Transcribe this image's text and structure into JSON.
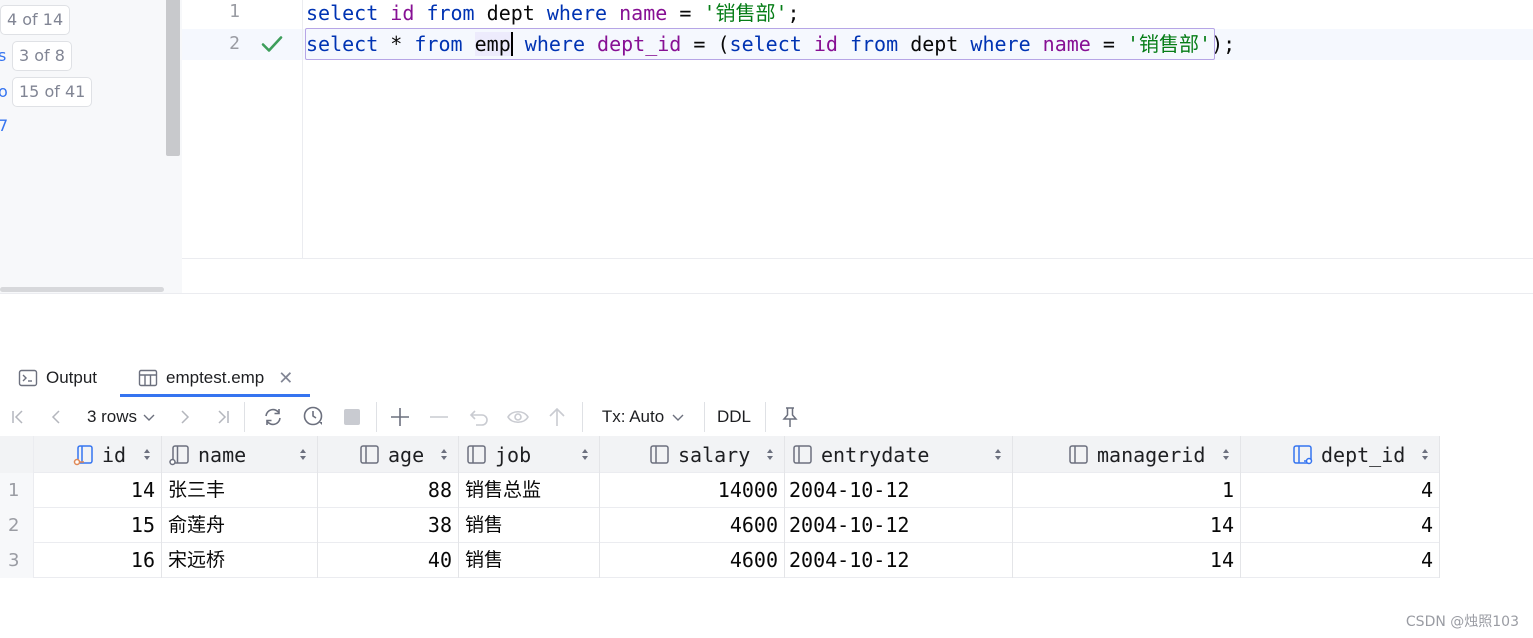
{
  "left_panel": {
    "badges": [
      "4 of 14",
      "3 of 8",
      "15 of 41"
    ]
  },
  "editor": {
    "line_numbers": [
      "1",
      "2"
    ],
    "line1": {
      "kw1": "select",
      "col": "id",
      "kw2": "from",
      "table": "dept",
      "kw3": "where",
      "field": "name",
      "op": "=",
      "string": "'销售部'",
      "end": ";"
    },
    "line2": {
      "kw1": "select",
      "star": "*",
      "kw2": "from",
      "table": "emp",
      "kw3": "where",
      "field": "dept_id",
      "op": "=",
      "paren_open": "(",
      "kw4": "select",
      "col": "id",
      "kw5": "from",
      "table2": "dept",
      "kw6": "where",
      "field2": "name",
      "op2": "=",
      "string": "'销售部'",
      "paren_close": ")",
      "end": ";"
    }
  },
  "tabs": [
    {
      "label": "Output",
      "icon": "console-icon"
    },
    {
      "label": "emptest.emp",
      "icon": "table-icon"
    }
  ],
  "toolbar": {
    "rows_label": "3 rows",
    "tx_label": "Tx: Auto",
    "ddl_label": "DDL"
  },
  "table": {
    "columns": [
      "id",
      "name",
      "age",
      "job",
      "salary",
      "entrydate",
      "managerid",
      "dept_id"
    ],
    "rows": [
      {
        "num": "1",
        "id": "14",
        "name": "张三丰",
        "age": "88",
        "job": "销售总监",
        "salary": "14000",
        "entrydate": "2004-10-12",
        "managerid": "1",
        "dept_id": "4"
      },
      {
        "num": "2",
        "id": "15",
        "name": "俞莲舟",
        "age": "38",
        "job": "销售",
        "salary": "4600",
        "entrydate": "2004-10-12",
        "managerid": "14",
        "dept_id": "4"
      },
      {
        "num": "3",
        "id": "16",
        "name": "宋远桥",
        "age": "40",
        "job": "销售",
        "salary": "4600",
        "entrydate": "2004-10-12",
        "managerid": "14",
        "dept_id": "4"
      }
    ]
  },
  "watermark": "CSDN @烛照103",
  "colors": {
    "keyword": "#0033b3",
    "field": "#871094",
    "string": "#067d17",
    "accent": "#3574f0",
    "success": "#3d9e5b"
  }
}
